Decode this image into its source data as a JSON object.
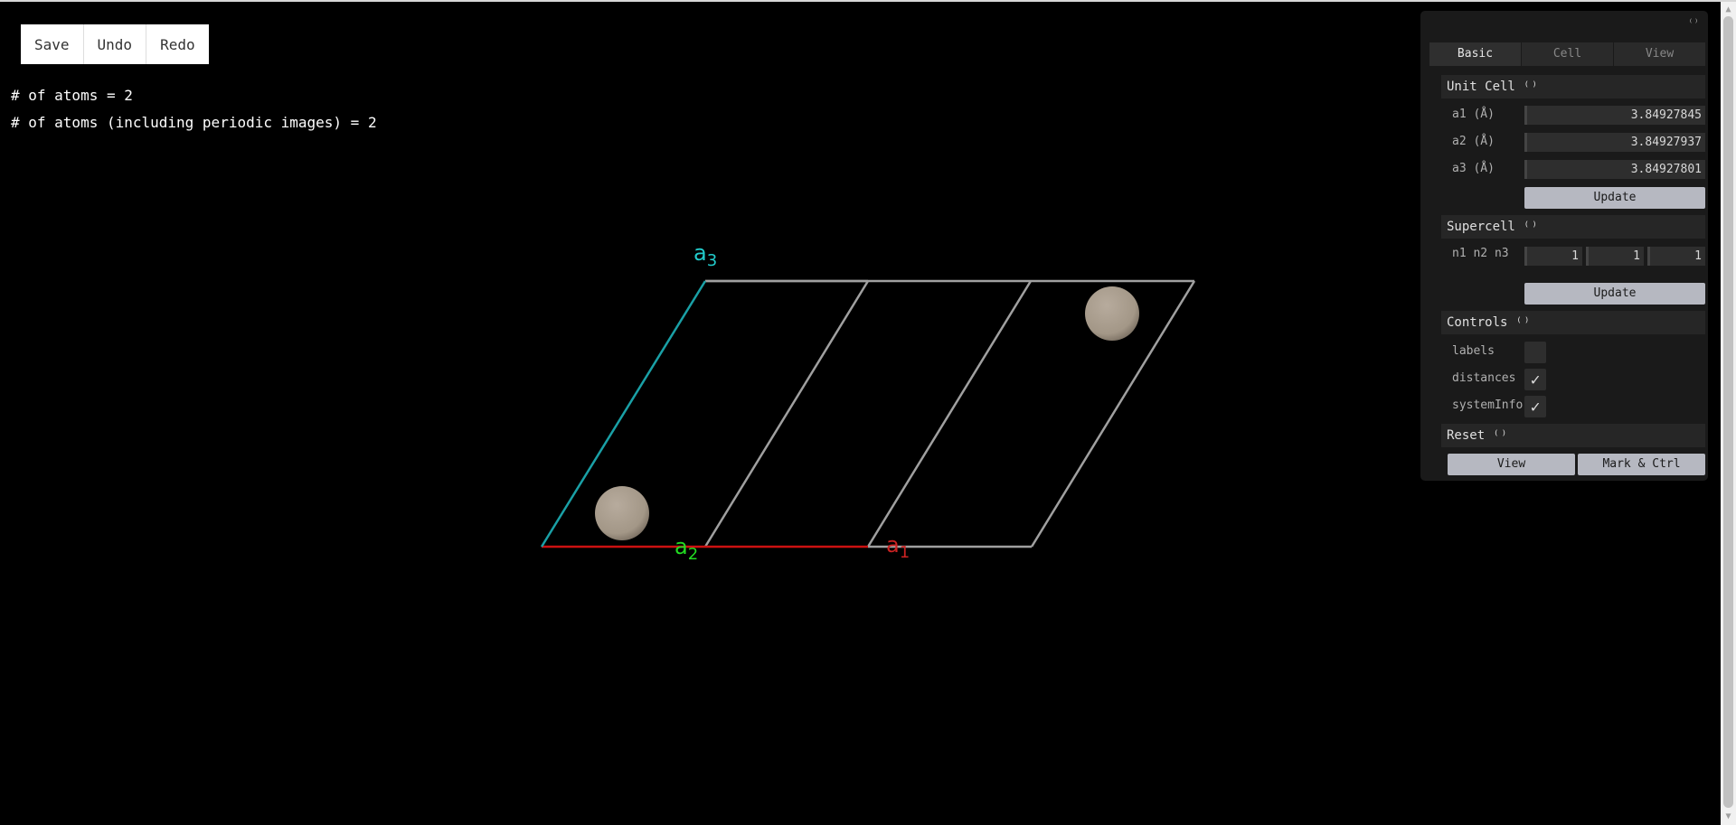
{
  "toolbar": {
    "save": "Save",
    "undo": "Undo",
    "redo": "Redo"
  },
  "system_info": {
    "atoms": "# of atoms = 2",
    "atoms_periodic": "# of atoms (including periodic images) = 2"
  },
  "axes": {
    "a1": {
      "letter": "a",
      "sub": "1",
      "color": "#cc2222"
    },
    "a2": {
      "letter": "a",
      "sub": "2",
      "color": "#22dd22"
    },
    "a3": {
      "letter": "a",
      "sub": "3",
      "color": "#22cccc"
    }
  },
  "colors": {
    "cell_edge": "#a0a0a0",
    "a1_edge": "#cc1111",
    "a3_edge": "#1aa0a6",
    "atom": "#aa9d8e"
  },
  "gui": {
    "toggle": "⁽⁾",
    "tabs": [
      "Basic",
      "Cell",
      "View"
    ],
    "unit_cell": {
      "title": "Unit Cell",
      "rows": [
        {
          "label": "a1 (Å)",
          "value": "3.84927845"
        },
        {
          "label": "a2 (Å)",
          "value": "3.84927937"
        },
        {
          "label": "a3 (Å)",
          "value": "3.84927801"
        }
      ],
      "update": "Update"
    },
    "supercell": {
      "title": "Supercell",
      "label": "n1 n2 n3",
      "values": [
        "1",
        "1",
        "1"
      ],
      "update": "Update"
    },
    "controls": {
      "title": "Controls",
      "labels": "labels",
      "labels_checked": false,
      "distances": "distances",
      "distances_checked": true,
      "systemInfo": "systemInfo",
      "systemInfo_checked": true
    },
    "reset": {
      "title": "Reset",
      "view": "View",
      "mark_ctrl": "Mark & Ctrl"
    }
  }
}
